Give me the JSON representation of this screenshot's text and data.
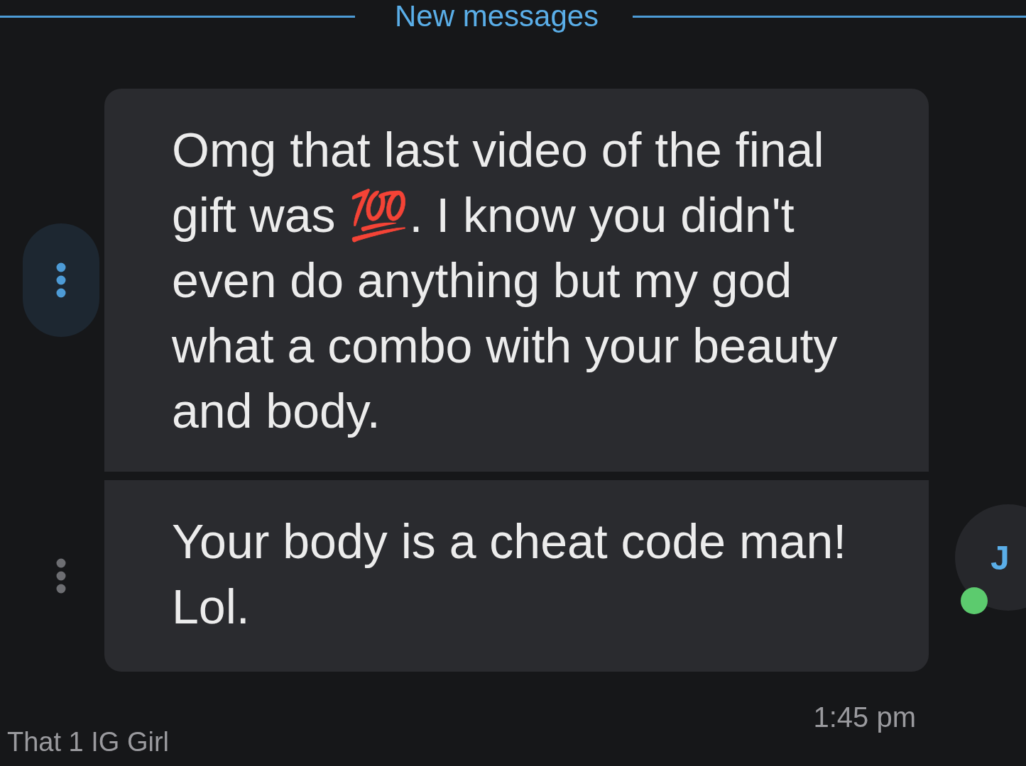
{
  "divider": {
    "label": "New messages"
  },
  "messages": [
    {
      "text": "Omg that last video of the final gift was 💯. I know you didn't even do anything but my god what a combo with your beauty and body.",
      "menu_selected": true
    },
    {
      "text": "Your body is a cheat code man! Lol.",
      "menu_selected": false
    }
  ],
  "avatar": {
    "initials": "J",
    "online": true
  },
  "time": "1:45 pm",
  "sender": "That 1 IG Girl"
}
